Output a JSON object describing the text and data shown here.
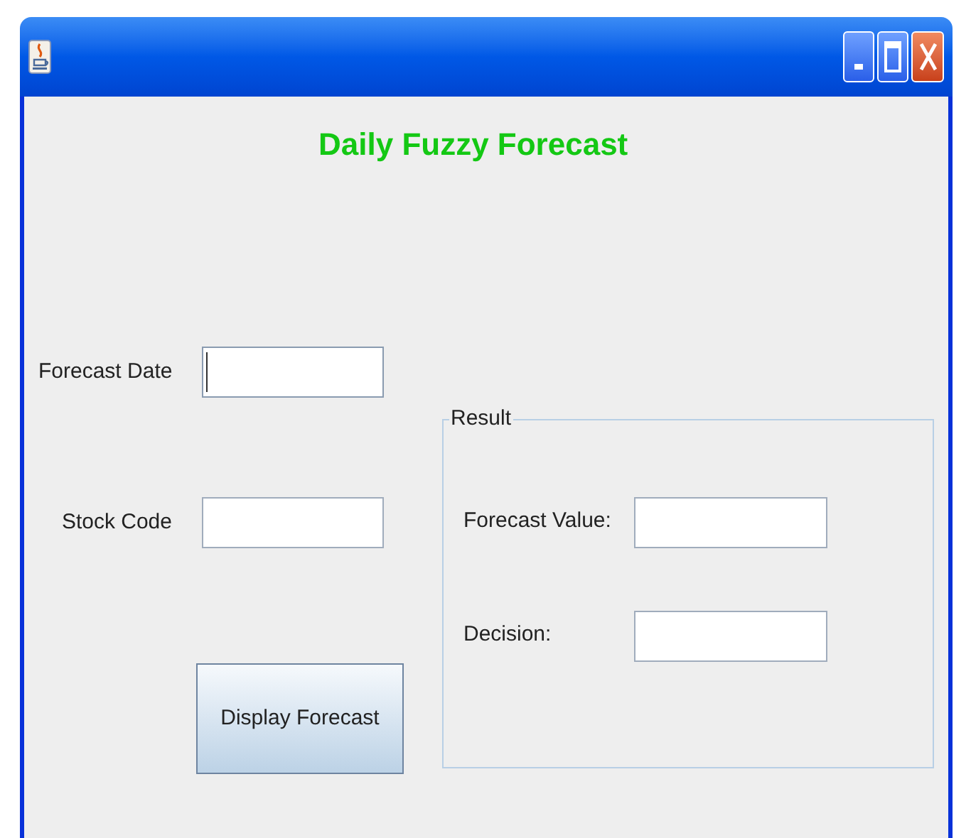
{
  "heading": "Daily Fuzzy Forecast",
  "inputs": [
    {
      "label": "Forecast Date",
      "focused": true
    },
    {
      "label": "Stock Code",
      "focused": false
    }
  ],
  "button": "Display Forecast",
  "result": {
    "legend": "Result",
    "fields": [
      {
        "label": "Forecast Value:"
      },
      {
        "label": "Decision:"
      }
    ]
  }
}
